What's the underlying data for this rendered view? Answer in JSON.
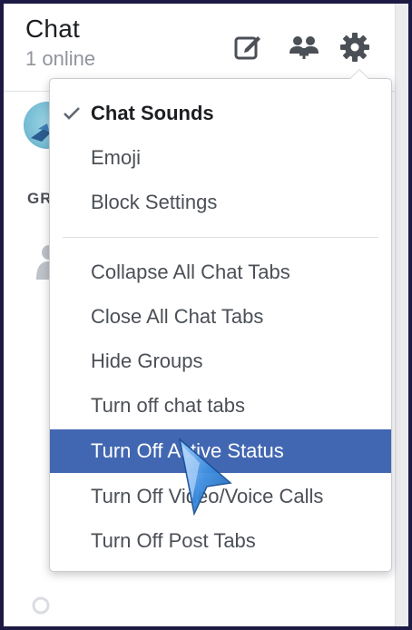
{
  "header": {
    "title": "Chat",
    "subtitle": "1 online"
  },
  "icons": {
    "compose": "compose-icon",
    "people": "people-icon",
    "settings": "gear-icon"
  },
  "list": {
    "groups_label": "GR"
  },
  "menu": {
    "items": [
      {
        "label": "Chat Sounds",
        "checked": true
      },
      {
        "label": "Emoji"
      },
      {
        "label": "Block Settings"
      },
      {
        "label": "Collapse All Chat Tabs"
      },
      {
        "label": "Close All Chat Tabs"
      },
      {
        "label": "Hide Groups"
      },
      {
        "label": "Turn off chat tabs"
      },
      {
        "label": "Turn Off Active Status",
        "highlighted": true
      },
      {
        "label": "Turn Off Video/Voice Calls"
      },
      {
        "label": "Turn Off Post Tabs"
      }
    ]
  },
  "colors": {
    "highlight": "#4267b2",
    "text": "#4b4f56",
    "cursor": "#3d8ee0"
  }
}
